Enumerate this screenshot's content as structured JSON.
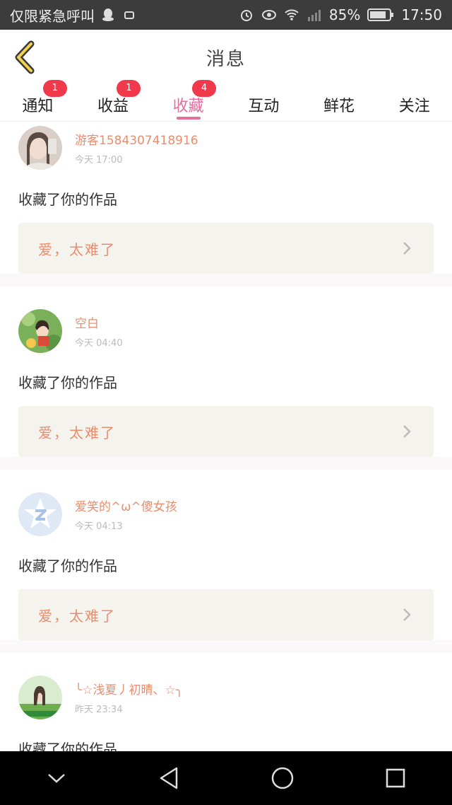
{
  "status_bar": {
    "carrier": "仅限紧急呼叫",
    "battery": "85%",
    "time": "17:50"
  },
  "header": {
    "title": "消息"
  },
  "tabs": [
    {
      "label": "通知",
      "badge": "1"
    },
    {
      "label": "收益",
      "badge": "1"
    },
    {
      "label": "收藏",
      "badge": "4",
      "active": true
    },
    {
      "label": "互动",
      "badge": ""
    },
    {
      "label": "鲜花",
      "badge": ""
    },
    {
      "label": "关注",
      "badge": ""
    }
  ],
  "feed": [
    {
      "username": "游客1584307418916",
      "time": "今天 17:00",
      "action": "收藏了你的作品",
      "work": "爱，太难了"
    },
    {
      "username": "空白",
      "time": "今天 04:40",
      "action": "收藏了你的作品",
      "work": "爱，太难了"
    },
    {
      "username": "爱笑的^ω^傻女孩",
      "time": "今天 04:13",
      "action": "收藏了你的作品",
      "work": "爱，太难了"
    },
    {
      "username": "╰☆浅夏丿初晴、☆╮",
      "time": "昨天 23:34",
      "action": "收藏了你的作品",
      "work": ""
    }
  ],
  "colors": {
    "accent": "#e46f9c",
    "username": "#e98d6e",
    "badge": "#f03a4b"
  }
}
